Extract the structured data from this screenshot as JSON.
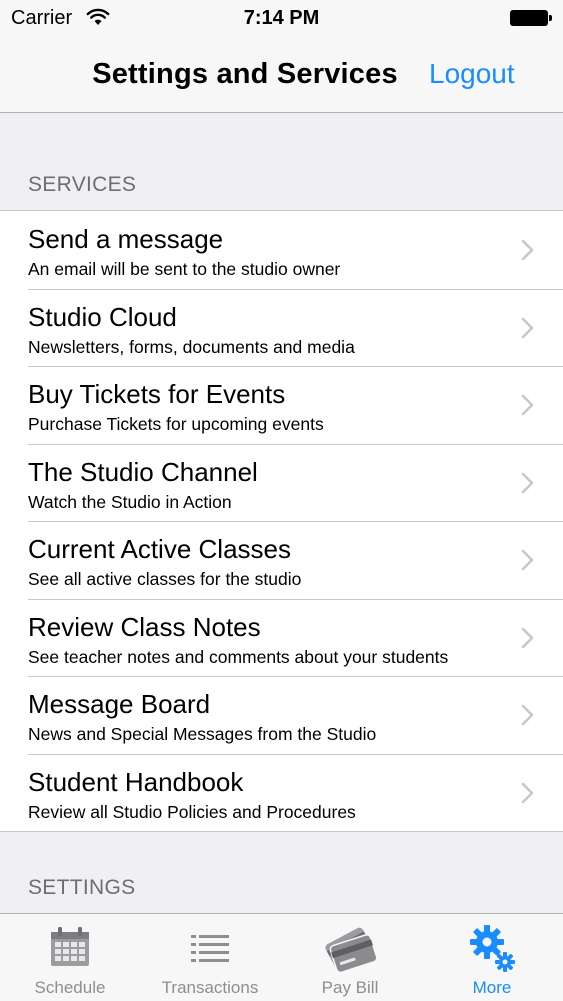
{
  "status_bar": {
    "carrier": "Carrier",
    "time": "7:14 PM"
  },
  "nav": {
    "title": "Settings and Services",
    "logout_label": "Logout"
  },
  "sections": {
    "services_header": "SERVICES",
    "settings_header": "SETTINGS"
  },
  "services": [
    {
      "title": "Send a message",
      "subtitle": "An email will be sent to the studio owner"
    },
    {
      "title": "Studio Cloud",
      "subtitle": "Newsletters, forms, documents and media"
    },
    {
      "title": "Buy Tickets for Events",
      "subtitle": "Purchase Tickets for upcoming events"
    },
    {
      "title": "The Studio Channel",
      "subtitle": "Watch the Studio in Action"
    },
    {
      "title": "Current Active Classes",
      "subtitle": "See all active classes for the studio"
    },
    {
      "title": "Review Class Notes",
      "subtitle": "See teacher notes and comments about your students"
    },
    {
      "title": "Message Board",
      "subtitle": "News and Special Messages from the Studio"
    },
    {
      "title": "Student Handbook",
      "subtitle": "Review all Studio Policies and Procedures"
    }
  ],
  "tabs": [
    {
      "label": "Schedule",
      "icon": "calendar-icon",
      "active": false
    },
    {
      "label": "Transactions",
      "icon": "list-icon",
      "active": false
    },
    {
      "label": "Pay Bill",
      "icon": "credit-card-icon",
      "active": false
    },
    {
      "label": "More",
      "icon": "gears-icon",
      "active": true
    }
  ],
  "colors": {
    "accent": "#1a8cff",
    "inactive_tab": "#8e8e93",
    "background": "#efeff4"
  }
}
